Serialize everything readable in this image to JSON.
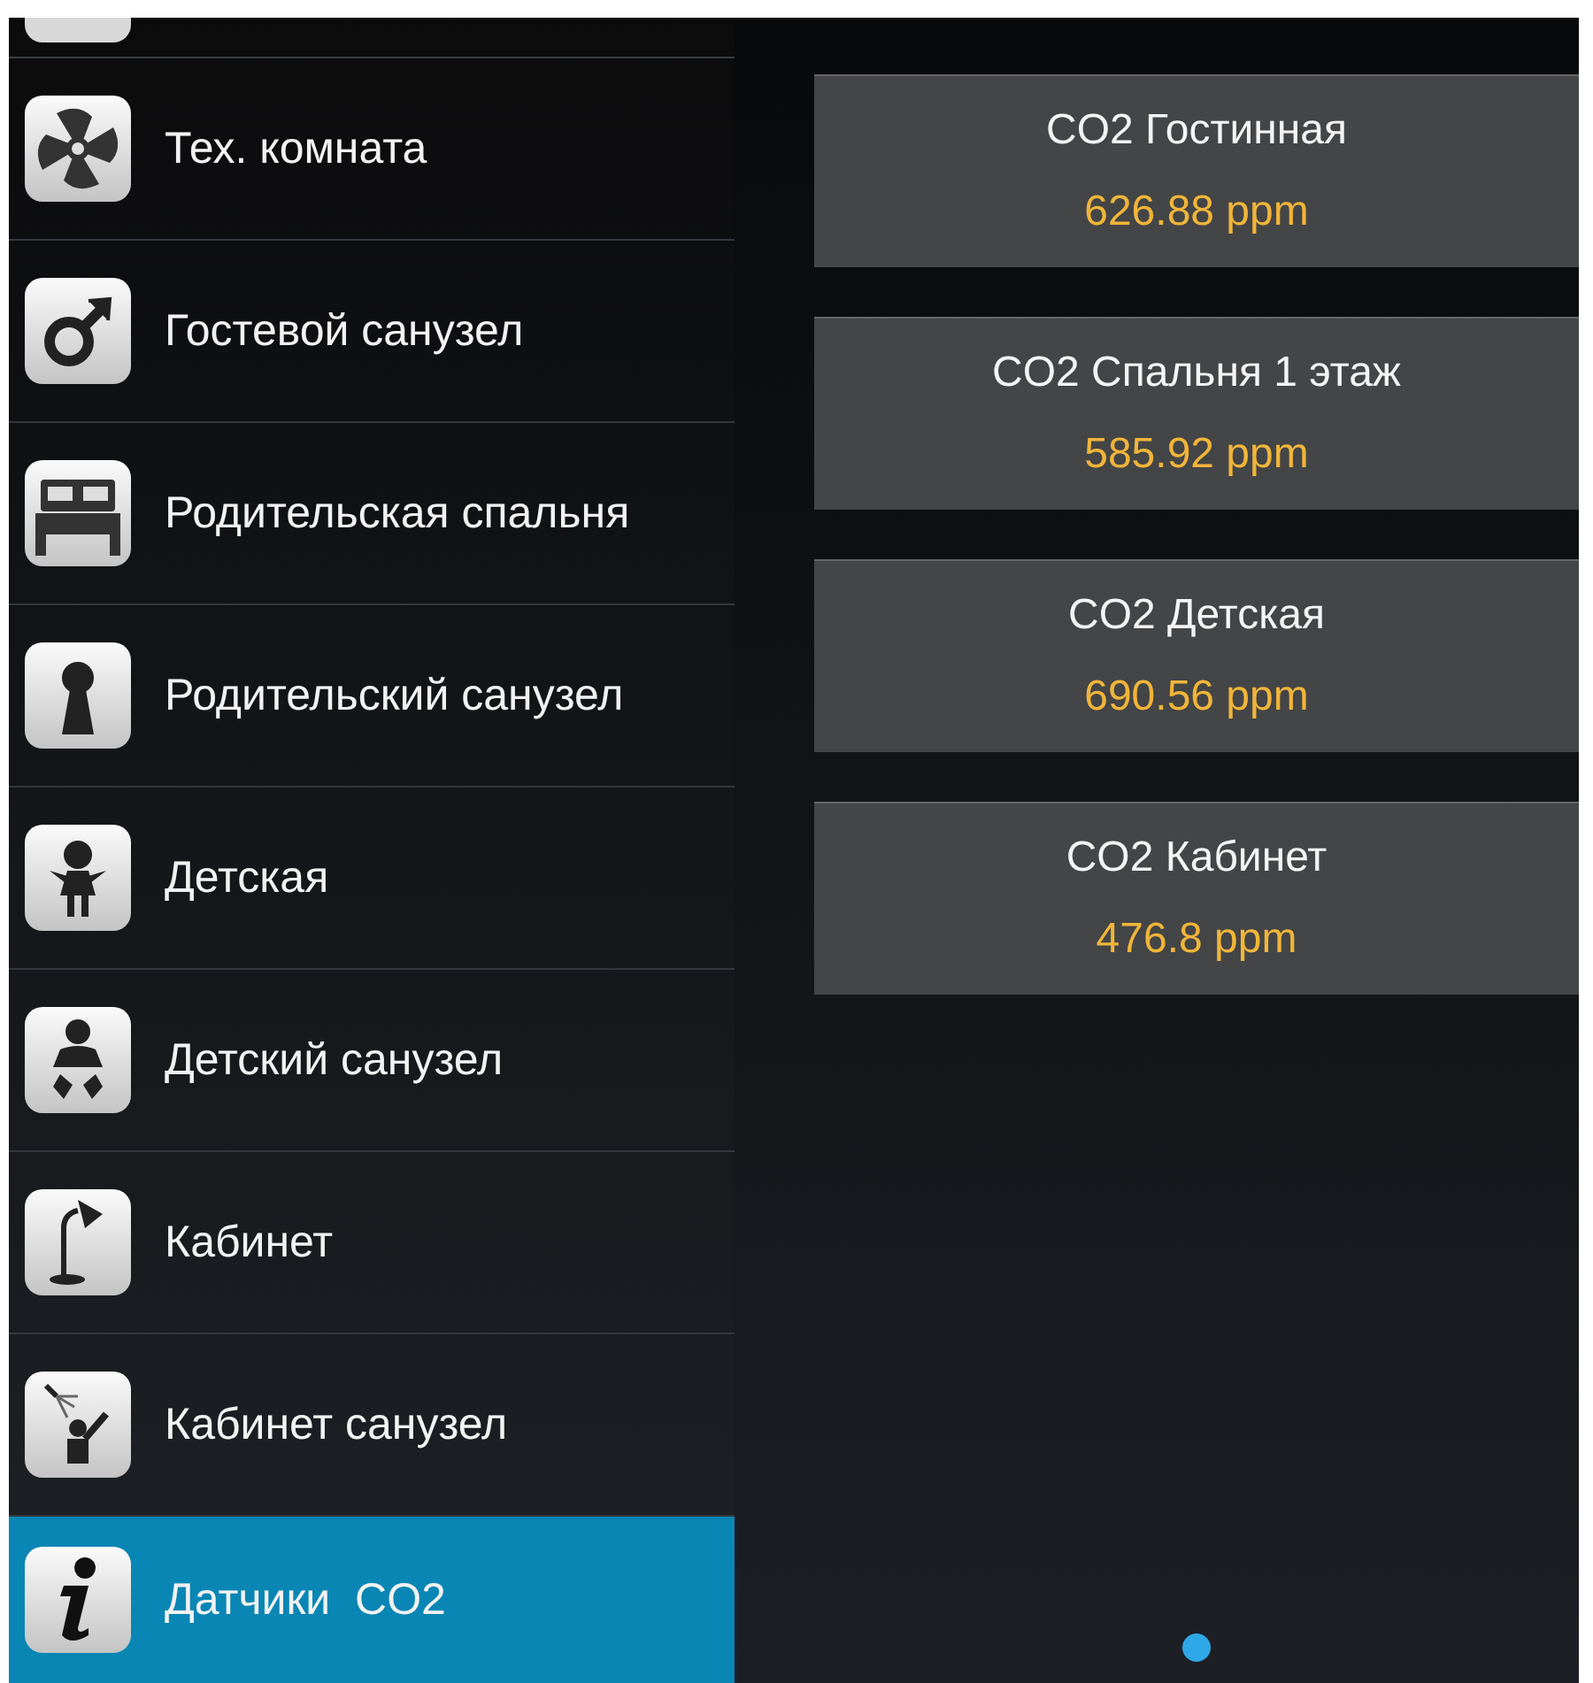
{
  "menu": [
    {
      "label": "Тех. комната",
      "kind": "fan",
      "selected": false
    },
    {
      "label": "Гостевой санузел",
      "kind": "male",
      "selected": false
    },
    {
      "label": "Родительская спальня",
      "kind": "bed",
      "selected": false
    },
    {
      "label": "Родительский санузел",
      "kind": "keyhole",
      "selected": false
    },
    {
      "label": "Детская",
      "kind": "girl",
      "selected": false
    },
    {
      "label": "Детский санузел",
      "kind": "baby",
      "selected": false
    },
    {
      "label": "Кабинет",
      "kind": "lamp",
      "selected": false
    },
    {
      "label": "Кабинет санузел",
      "kind": "shower",
      "selected": false
    },
    {
      "label": "Датчики  CO2",
      "kind": "info",
      "selected": true
    }
  ],
  "sensors": [
    {
      "name": "CO2 Гостинная",
      "value": "626.88 ppm"
    },
    {
      "name": "CO2 Спальня 1 этаж",
      "value": "585.92 ppm"
    },
    {
      "name": "CO2 Детская",
      "value": "690.56 ppm"
    },
    {
      "name": "CO2 Кабинет",
      "value": "476.8 ppm"
    }
  ],
  "pager": [
    {
      "selected": true
    }
  ]
}
